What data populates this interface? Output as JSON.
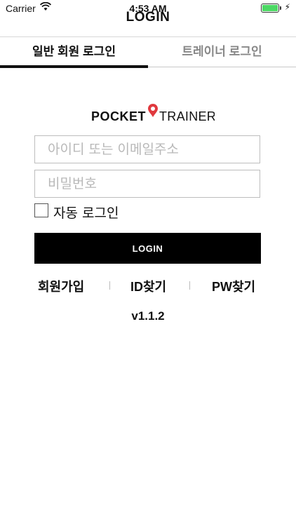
{
  "status_bar": {
    "carrier": "Carrier",
    "time": "4:53 AM"
  },
  "nav": {
    "title": "LOGIN"
  },
  "tabs": [
    {
      "label": "일반 회원 로그인",
      "selected": true
    },
    {
      "label": "트레이너 로그인",
      "selected": false
    }
  ],
  "logo": {
    "left": "POCKET",
    "right": "TRAINER",
    "accent": "#e0393e"
  },
  "form": {
    "id_placeholder": "아이디 또는 이메일주소",
    "id_value": "",
    "pw_placeholder": "비밀번호",
    "pw_value": "",
    "auto_login_label": "자동 로그인",
    "auto_login_checked": false,
    "login_button": "LOGIN"
  },
  "links": {
    "signup": "회원가입",
    "find_id": "ID찾기",
    "find_pw": "PW찾기"
  },
  "version": "v1.1.2",
  "colors": {
    "button_bg": "#000000",
    "tab_active": "#111111",
    "tab_inactive": "#888888"
  }
}
